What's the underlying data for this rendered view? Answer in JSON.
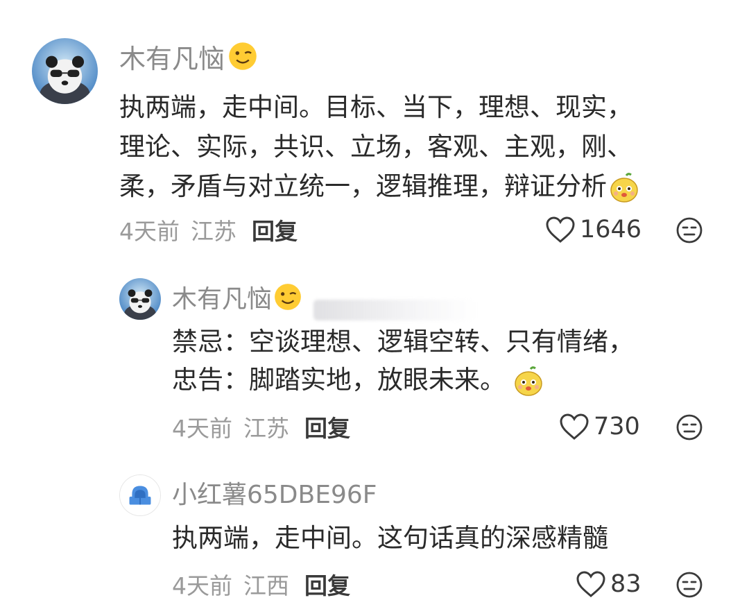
{
  "comments": [
    {
      "username": "木有凡恼",
      "emoji_after_name": "wink-emoji",
      "content_lines": [
        "执两端，走中间。目标、当下，理想、现实，",
        "理论、实际，共识、立场，客观、主观，刚、",
        "柔，矛盾与对立统一，逻辑推理，辩证分析"
      ],
      "trailing_emoji": "yellow-fruit-emoji",
      "time": "4天前",
      "location": "江苏",
      "reply_label": "回复",
      "likes": "1646",
      "replies": [
        {
          "username": "木有凡恼",
          "emoji_after_name": "wink-emoji",
          "content_lines": [
            "禁忌：空谈理想、逻辑空转、只有情绪，",
            "忠告：脚踏实地，放眼未来。"
          ],
          "trailing_emoji": "yellow-fruit-emoji",
          "time": "4天前",
          "location": "江苏",
          "reply_label": "回复",
          "likes": "730"
        },
        {
          "username": "小红薯65DBE96F",
          "content_lines": [
            "执两端，走中间。这句话真的深感精髓"
          ],
          "time": "4天前",
          "location": "江西",
          "reply_label": "回复",
          "likes": "83"
        }
      ]
    }
  ],
  "icons": {
    "like": "heart-outline-icon",
    "dislike": "neutral-face-icon"
  },
  "colors": {
    "username": "#8a8a8a",
    "content": "#2a2a2a",
    "meta": "#9a9a9a",
    "reply": "#3a3a3a"
  }
}
